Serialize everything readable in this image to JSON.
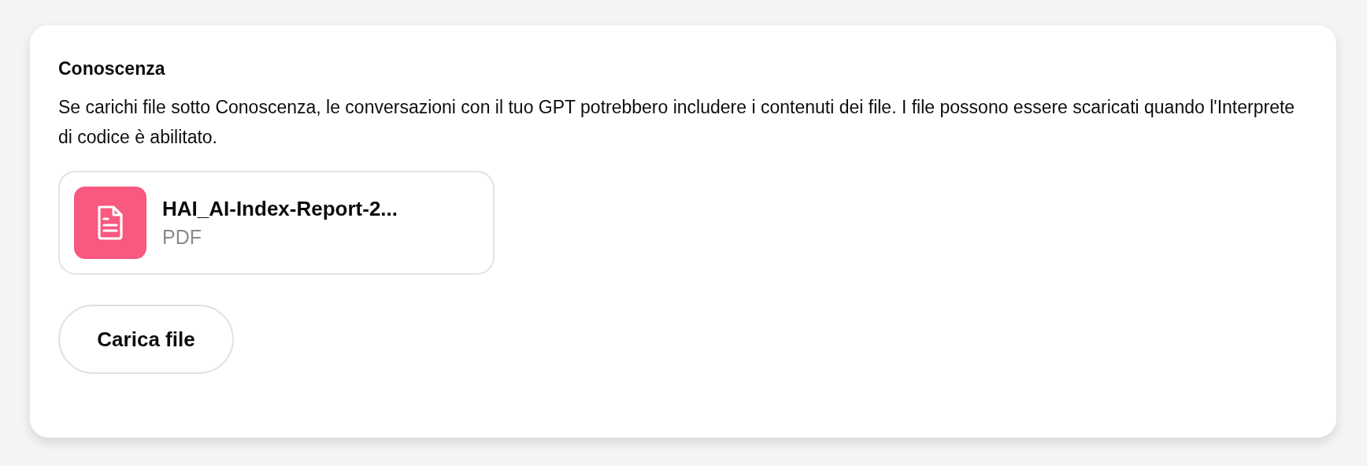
{
  "section": {
    "title": "Conoscenza",
    "description": "Se carichi file sotto Conoscenza, le conversazioni con il tuo GPT potrebbero includere i contenuti dei file. I file possono essere scaricati quando l'Interprete di codice è abilitato."
  },
  "files": [
    {
      "name": "HAI_AI-Index-Report-2...",
      "type": "PDF"
    }
  ],
  "upload_button": "Carica file"
}
